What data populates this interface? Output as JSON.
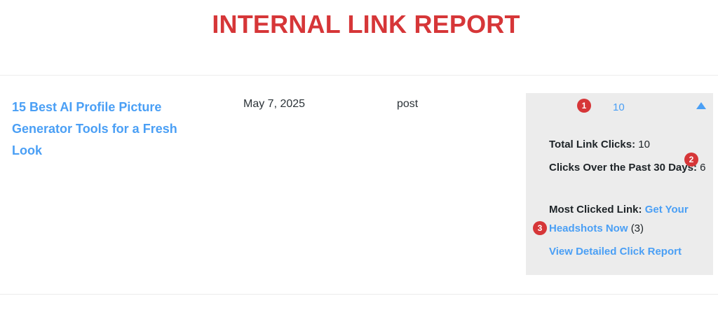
{
  "header": {
    "title": "INTERNAL LINK REPORT"
  },
  "row": {
    "post_title": "15 Best AI Profile Picture Generator Tools for a Fresh Look",
    "date": "May 7, 2025",
    "type": "post",
    "clicks": "10"
  },
  "stats": {
    "total_label": "Total Link Clicks:",
    "total_value": "10",
    "past30_label": "Clicks Over the Past 30 Days:",
    "past30_value": "6",
    "most_label": "Most Clicked Link:",
    "most_link": "Get Your Headshots Now",
    "most_count": "(3)",
    "report_link": "View Detailed Click Report"
  },
  "markers": [
    "1",
    "2",
    "3"
  ],
  "colors": {
    "accent_red": "#d63638",
    "link_blue": "#4a9ff5",
    "panel_bg": "#ececec"
  },
  "icons": {
    "toggle": "triangle-up-icon"
  }
}
